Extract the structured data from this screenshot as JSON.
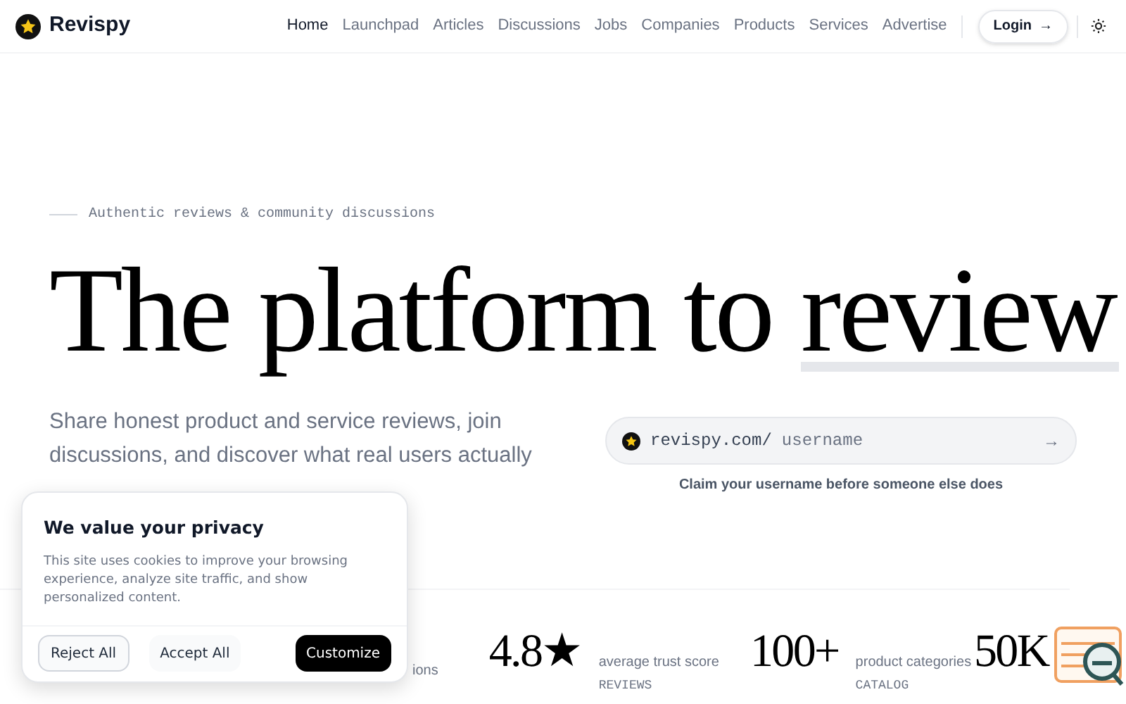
{
  "brand": {
    "name": "Revispy"
  },
  "nav": [
    {
      "label": "Home",
      "selected": true
    },
    {
      "label": "Launchpad",
      "selected": false
    },
    {
      "label": "Articles",
      "selected": false
    },
    {
      "label": "Discussions",
      "selected": false
    },
    {
      "label": "Jobs",
      "selected": false
    },
    {
      "label": "Companies",
      "selected": false
    },
    {
      "label": "Products",
      "selected": false
    },
    {
      "label": "Services",
      "selected": false
    },
    {
      "label": "Advertise",
      "selected": false
    }
  ],
  "login": {
    "label": "Login",
    "arrow": "→"
  },
  "hero": {
    "tagline": "Authentic reviews & community discussions",
    "title_start": "The platform to",
    "title_highlight": "review",
    "description": "Share honest product and service reviews, join discussions, and discover what real users actually"
  },
  "claim": {
    "prefix": "revispy.com/",
    "placeholder": "username",
    "arrow": "→",
    "caption": "Claim your username before someone else does"
  },
  "stats": [
    {
      "kind": "partial",
      "label": "ions"
    },
    {
      "kind": "full",
      "value": "4.8★",
      "label": "average trust score",
      "tag": "REVIEWS"
    },
    {
      "kind": "full",
      "value": "100+",
      "label": "product categories",
      "tag": "CATALOG"
    },
    {
      "kind": "value_only",
      "value": "50K"
    }
  ],
  "cookie": {
    "title": "We value your privacy",
    "text": "This site uses cookies to improve your browsing experience, analyze site traffic, and show personalized content.",
    "buttons": [
      {
        "label": "Reject All",
        "kind": "outline"
      },
      {
        "label": "Accept All",
        "kind": "soft"
      },
      {
        "label": "Customize",
        "kind": "solid"
      }
    ]
  }
}
